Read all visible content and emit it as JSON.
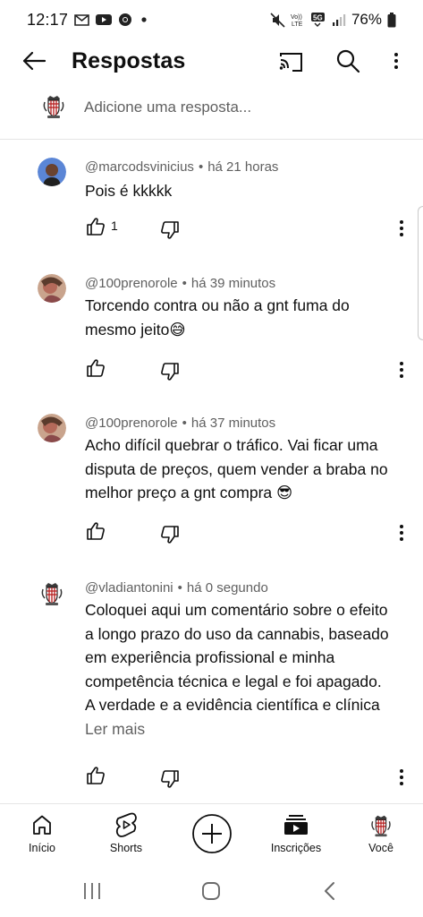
{
  "status_bar": {
    "time": "12:17",
    "battery": "76%",
    "network_type": "5G",
    "volte_label": "VoLTE",
    "icons": [
      "gmail-icon",
      "youtube-icon",
      "chrome-icon",
      "dot-icon",
      "mute-icon",
      "signal-icon",
      "battery-icon"
    ]
  },
  "header": {
    "title": "Respostas"
  },
  "add_reply": {
    "placeholder": "Adicione uma resposta..."
  },
  "comments": [
    {
      "author": "@marcodsvinicius",
      "time": "há 21 horas",
      "text": "Pois é kkkkk",
      "likes": "1"
    },
    {
      "author": "@100prenorole",
      "time": "há 39 minutos",
      "text": "Torcendo contra ou não a gnt fuma do mesmo jeito😅",
      "likes": ""
    },
    {
      "author": "@100prenorole",
      "time": "há 37 minutos",
      "text": "Acho difícil quebrar o tráfico. Vai ficar uma disputa de preços,  quem vender a braba no melhor preço a gnt compra 😎",
      "likes": ""
    },
    {
      "author": "@vladiantonini",
      "time": "há 0 segundo",
      "text": "Coloquei aqui um comentário sobre o efeito a longo prazo do uso da cannabis, baseado em experiência profissional e minha competência técnica e legal e foi apagado. A verdade e a evidência científica e clínica",
      "likes": "",
      "read_more": "Ler mais"
    }
  ],
  "bottom_nav": {
    "items": [
      {
        "label": "Início",
        "icon": "home-icon"
      },
      {
        "label": "Shorts",
        "icon": "shorts-icon"
      },
      {
        "label": "",
        "icon": "create-icon"
      },
      {
        "label": "Inscrições",
        "icon": "subscriptions-icon"
      },
      {
        "label": "Você",
        "icon": "avatar-icon"
      }
    ]
  },
  "system_nav": {
    "icons": [
      "recents-icon",
      "home-circle-icon",
      "back-chevron-icon"
    ]
  },
  "colors": {
    "text_primary": "#0f0f0f",
    "text_secondary": "#606060",
    "divider": "#e5e5e5",
    "background": "#ffffff"
  }
}
